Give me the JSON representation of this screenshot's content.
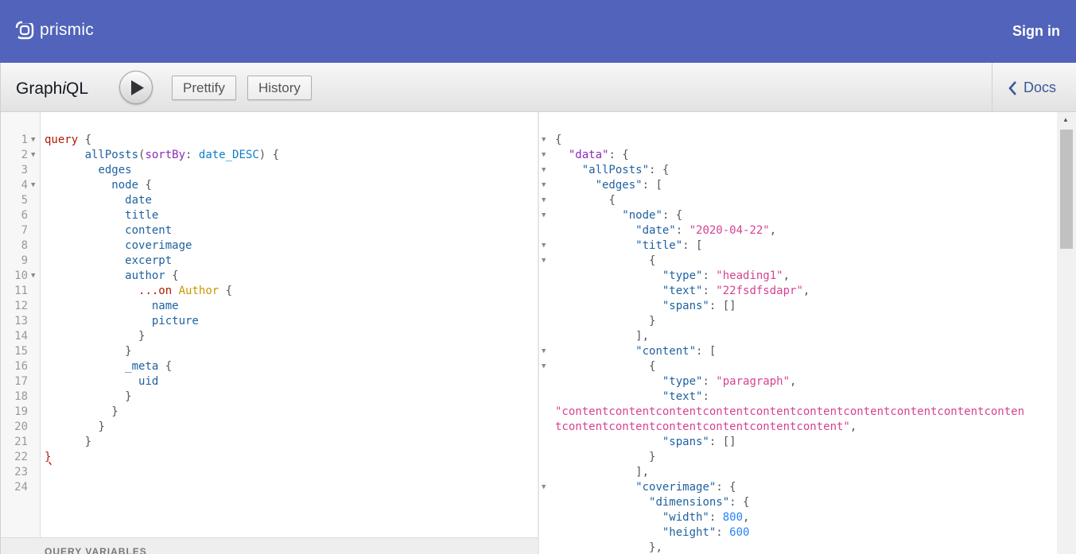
{
  "header": {
    "brand_name": "prismic",
    "sign_in": "Sign in",
    "brand_color": "#5163ba"
  },
  "toolbar": {
    "title_prefix": "Graph",
    "title_italic": "i",
    "title_suffix": "QL",
    "execute_icon": "play-icon",
    "prettify": "Prettify",
    "history": "History",
    "docs": "Docs"
  },
  "query_editor": {
    "lines": [
      {
        "n": "1",
        "fold": true,
        "segs": [
          [
            "k",
            "query"
          ],
          [
            "p",
            " {"
          ]
        ]
      },
      {
        "n": "2",
        "fold": true,
        "segs": [
          [
            "d",
            "      "
          ],
          [
            "f",
            "allPosts"
          ],
          [
            "p",
            "("
          ],
          [
            "a",
            "sortBy"
          ],
          [
            "p",
            ": "
          ],
          [
            "v",
            "date_DESC"
          ],
          [
            "p",
            ") {"
          ]
        ]
      },
      {
        "n": "3",
        "fold": false,
        "segs": [
          [
            "d",
            "        "
          ],
          [
            "f",
            "edges"
          ]
        ]
      },
      {
        "n": "4",
        "fold": true,
        "segs": [
          [
            "d",
            "          "
          ],
          [
            "f",
            "node"
          ],
          [
            "p",
            " {"
          ]
        ]
      },
      {
        "n": "5",
        "fold": false,
        "segs": [
          [
            "d",
            "            "
          ],
          [
            "f",
            "date"
          ]
        ]
      },
      {
        "n": "6",
        "fold": false,
        "segs": [
          [
            "d",
            "            "
          ],
          [
            "f",
            "title"
          ]
        ]
      },
      {
        "n": "7",
        "fold": false,
        "segs": [
          [
            "d",
            "            "
          ],
          [
            "f",
            "content"
          ]
        ]
      },
      {
        "n": "8",
        "fold": false,
        "segs": [
          [
            "d",
            "            "
          ],
          [
            "f",
            "coverimage"
          ]
        ]
      },
      {
        "n": "9",
        "fold": false,
        "segs": [
          [
            "d",
            "            "
          ],
          [
            "f",
            "excerpt"
          ]
        ]
      },
      {
        "n": "10",
        "fold": true,
        "segs": [
          [
            "d",
            "            "
          ],
          [
            "f",
            "author"
          ],
          [
            "p",
            " {"
          ]
        ]
      },
      {
        "n": "11",
        "fold": false,
        "segs": [
          [
            "d",
            "              "
          ],
          [
            "k",
            "...on"
          ],
          [
            "p",
            " "
          ],
          [
            "t",
            "Author"
          ],
          [
            "p",
            " {"
          ]
        ]
      },
      {
        "n": "12",
        "fold": false,
        "segs": [
          [
            "d",
            "                "
          ],
          [
            "f",
            "name"
          ]
        ]
      },
      {
        "n": "13",
        "fold": false,
        "segs": [
          [
            "d",
            "                "
          ],
          [
            "f",
            "picture"
          ]
        ]
      },
      {
        "n": "14",
        "fold": false,
        "segs": [
          [
            "d",
            "              "
          ],
          [
            "p",
            "}"
          ]
        ]
      },
      {
        "n": "15",
        "fold": false,
        "segs": [
          [
            "d",
            "            "
          ],
          [
            "p",
            "}"
          ]
        ]
      },
      {
        "n": "16",
        "fold": false,
        "segs": [
          [
            "d",
            "            "
          ],
          [
            "f",
            "_meta"
          ],
          [
            "p",
            " {"
          ]
        ]
      },
      {
        "n": "17",
        "fold": false,
        "segs": [
          [
            "d",
            "              "
          ],
          [
            "f",
            "uid"
          ]
        ]
      },
      {
        "n": "18",
        "fold": false,
        "segs": [
          [
            "d",
            "            "
          ],
          [
            "p",
            "}"
          ]
        ]
      },
      {
        "n": "19",
        "fold": false,
        "segs": [
          [
            "d",
            "          "
          ],
          [
            "p",
            "}"
          ]
        ]
      },
      {
        "n": "20",
        "fold": false,
        "segs": [
          [
            "d",
            "        "
          ],
          [
            "p",
            "}"
          ]
        ]
      },
      {
        "n": "21",
        "fold": false,
        "segs": [
          [
            "d",
            "      "
          ],
          [
            "p",
            "}"
          ]
        ]
      },
      {
        "n": "22",
        "fold": false,
        "segs": [
          [
            "mark",
            "}"
          ]
        ]
      },
      {
        "n": "23",
        "fold": false,
        "segs": []
      },
      {
        "n": "24",
        "fold": false,
        "segs": []
      }
    ],
    "variables_title": "QUERY VARIABLES"
  },
  "result_viewer": {
    "lines": [
      {
        "fold": true,
        "segs": [
          [
            "p",
            "{"
          ]
        ]
      },
      {
        "fold": true,
        "segs": [
          [
            "d",
            "  "
          ],
          [
            "a",
            "\"data\""
          ],
          [
            "p",
            ": {"
          ]
        ]
      },
      {
        "fold": true,
        "segs": [
          [
            "d",
            "    "
          ],
          [
            "f",
            "\"allPosts\""
          ],
          [
            "p",
            ": {"
          ]
        ]
      },
      {
        "fold": true,
        "segs": [
          [
            "d",
            "      "
          ],
          [
            "f",
            "\"edges\""
          ],
          [
            "p",
            ": ["
          ]
        ]
      },
      {
        "fold": true,
        "segs": [
          [
            "d",
            "        "
          ],
          [
            "p",
            "{"
          ]
        ]
      },
      {
        "fold": true,
        "segs": [
          [
            "d",
            "          "
          ],
          [
            "f",
            "\"node\""
          ],
          [
            "p",
            ": {"
          ]
        ]
      },
      {
        "fold": false,
        "segs": [
          [
            "d",
            "            "
          ],
          [
            "f",
            "\"date\""
          ],
          [
            "p",
            ": "
          ],
          [
            "s",
            "\"2020-04-22\""
          ],
          [
            "p",
            ","
          ]
        ]
      },
      {
        "fold": true,
        "segs": [
          [
            "d",
            "            "
          ],
          [
            "f",
            "\"title\""
          ],
          [
            "p",
            ": ["
          ]
        ]
      },
      {
        "fold": true,
        "segs": [
          [
            "d",
            "              "
          ],
          [
            "p",
            "{"
          ]
        ]
      },
      {
        "fold": false,
        "segs": [
          [
            "d",
            "                "
          ],
          [
            "f",
            "\"type\""
          ],
          [
            "p",
            ": "
          ],
          [
            "s",
            "\"heading1\""
          ],
          [
            "p",
            ","
          ]
        ]
      },
      {
        "fold": false,
        "segs": [
          [
            "d",
            "                "
          ],
          [
            "f",
            "\"text\""
          ],
          [
            "p",
            ": "
          ],
          [
            "s",
            "\"22fsdfsdapr\""
          ],
          [
            "p",
            ","
          ]
        ]
      },
      {
        "fold": false,
        "segs": [
          [
            "d",
            "                "
          ],
          [
            "f",
            "\"spans\""
          ],
          [
            "p",
            ": []"
          ]
        ]
      },
      {
        "fold": false,
        "segs": [
          [
            "d",
            "              "
          ],
          [
            "p",
            "}"
          ]
        ]
      },
      {
        "fold": false,
        "segs": [
          [
            "d",
            "            "
          ],
          [
            "p",
            "],"
          ]
        ]
      },
      {
        "fold": true,
        "segs": [
          [
            "d",
            "            "
          ],
          [
            "f",
            "\"content\""
          ],
          [
            "p",
            ": ["
          ]
        ]
      },
      {
        "fold": true,
        "segs": [
          [
            "d",
            "              "
          ],
          [
            "p",
            "{"
          ]
        ]
      },
      {
        "fold": false,
        "segs": [
          [
            "d",
            "                "
          ],
          [
            "f",
            "\"type\""
          ],
          [
            "p",
            ": "
          ],
          [
            "s",
            "\"paragraph\""
          ],
          [
            "p",
            ","
          ]
        ]
      },
      {
        "fold": false,
        "segs": [
          [
            "d",
            "                "
          ],
          [
            "f",
            "\"text\""
          ],
          [
            "p",
            ":"
          ]
        ]
      },
      {
        "fold": false,
        "segs": [
          [
            "s",
            "\"contentcontentcontentcontentcontentcontentcontentcontentcontentconten"
          ]
        ]
      },
      {
        "fold": false,
        "segs": [
          [
            "s",
            "tcontentcontentcontentcontentcontentcontent\""
          ],
          [
            "p",
            ","
          ]
        ]
      },
      {
        "fold": false,
        "segs": [
          [
            "d",
            "                "
          ],
          [
            "f",
            "\"spans\""
          ],
          [
            "p",
            ": []"
          ]
        ]
      },
      {
        "fold": false,
        "segs": [
          [
            "d",
            "              "
          ],
          [
            "p",
            "}"
          ]
        ]
      },
      {
        "fold": false,
        "segs": [
          [
            "d",
            "            "
          ],
          [
            "p",
            "],"
          ]
        ]
      },
      {
        "fold": true,
        "segs": [
          [
            "d",
            "            "
          ],
          [
            "f",
            "\"coverimage\""
          ],
          [
            "p",
            ": {"
          ]
        ]
      },
      {
        "fold": false,
        "segs": [
          [
            "d",
            "              "
          ],
          [
            "f",
            "\"dimensions\""
          ],
          [
            "p",
            ": {"
          ]
        ]
      },
      {
        "fold": false,
        "segs": [
          [
            "d",
            "                "
          ],
          [
            "f",
            "\"width\""
          ],
          [
            "p",
            ": "
          ],
          [
            "n",
            "800"
          ],
          [
            "p",
            ","
          ]
        ]
      },
      {
        "fold": false,
        "segs": [
          [
            "d",
            "                "
          ],
          [
            "f",
            "\"height\""
          ],
          [
            "p",
            ": "
          ],
          [
            "n",
            "600"
          ]
        ]
      },
      {
        "fold": false,
        "segs": [
          [
            "d",
            "              "
          ],
          [
            "p",
            "},"
          ]
        ]
      }
    ]
  }
}
